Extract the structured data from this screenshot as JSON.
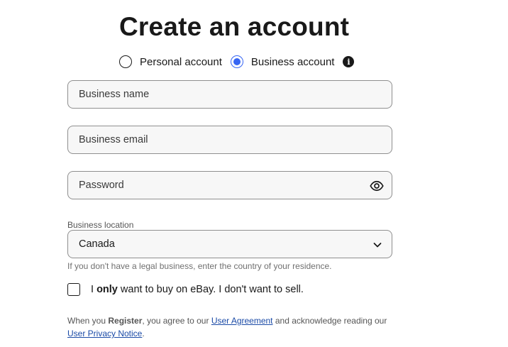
{
  "page": {
    "title": "Create an account"
  },
  "account_type": {
    "personal_label": "Personal account",
    "business_label": "Business account",
    "selected": "business",
    "info_icon": "info-icon"
  },
  "form": {
    "business_name_placeholder": "Business name",
    "business_email_placeholder": "Business email",
    "password_placeholder": "Password",
    "password_toggle_icon": "eye-icon",
    "location_label": "Business location",
    "location_value": "Canada",
    "location_helper": "If you don't have a legal business, enter the country of your residence.",
    "only_buy": {
      "prefix": "I ",
      "emphasis": "only",
      "suffix": " want to buy on eBay. I don't want to sell.",
      "checked": false
    }
  },
  "legal": {
    "part1": "When you ",
    "register": "Register",
    "part2": ", you agree to our ",
    "user_agreement": "User Agreement",
    "part3": " and acknowledge reading our ",
    "privacy_notice": "User Privacy Notice",
    "part4": "."
  },
  "colors": {
    "accent": "#3665f3",
    "link": "#1a4aa6",
    "field_bg": "#f7f7f7",
    "field_border": "#8f8f8f"
  }
}
